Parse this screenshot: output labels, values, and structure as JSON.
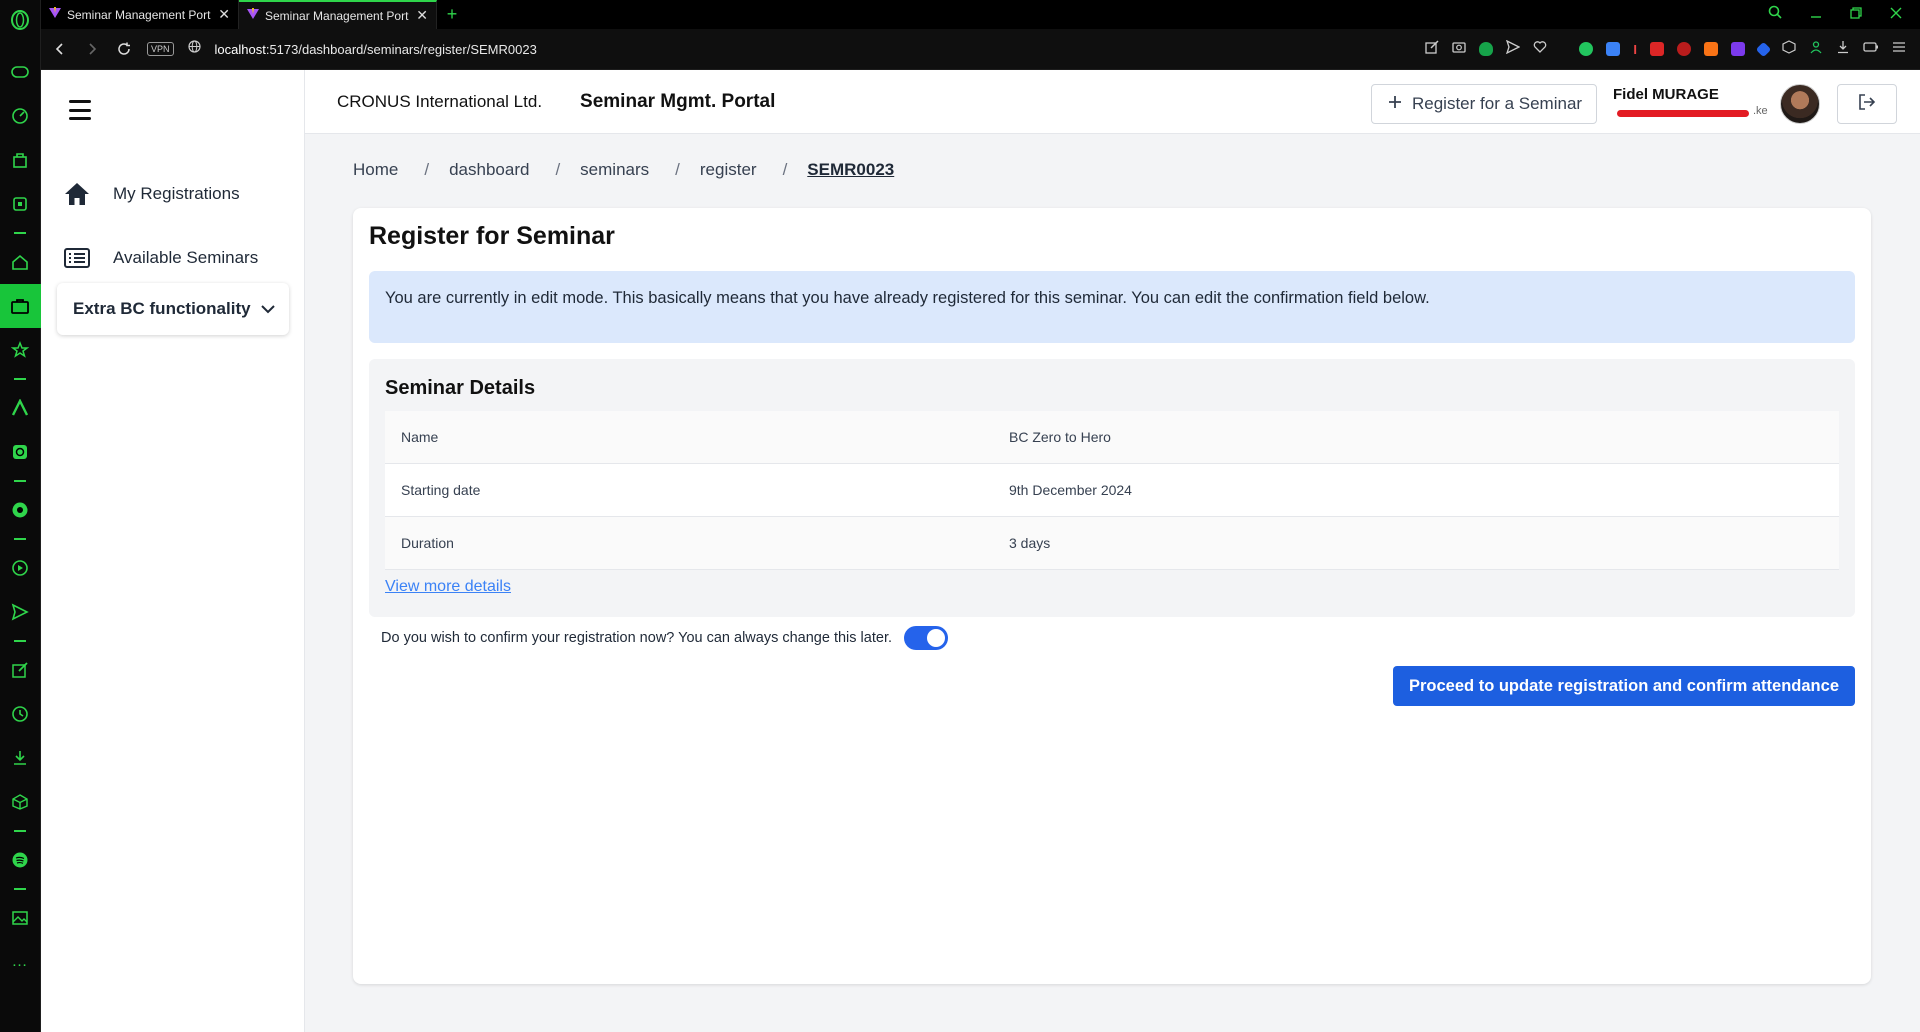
{
  "browser": {
    "tabs": [
      {
        "title": "Seminar Management Port"
      },
      {
        "title": "Seminar Management Port"
      }
    ],
    "vpn_label": "VPN",
    "url_host": "localhost",
    "url_path": ":5173/dashboard/seminars/register/SEMR0023"
  },
  "header": {
    "company": "CRONUS International Ltd.",
    "portal_title": "Seminar Mgmt. Portal",
    "register_button": "Register for a Seminar",
    "user_name": "Fidel MURAGE",
    "user_email_suffix": ".ke"
  },
  "sidebar": {
    "items": [
      {
        "label": "My Registrations",
        "icon": "home-icon"
      },
      {
        "label": "Available Seminars",
        "icon": "list-icon"
      }
    ],
    "extra_section": "Extra BC functionality"
  },
  "breadcrumb": [
    "Home",
    "dashboard",
    "seminars",
    "register",
    "SEMR0023"
  ],
  "page": {
    "title": "Register for Seminar",
    "alert": "You are currently in edit mode. This basically means that you have already registered for this seminar. You can edit the confirmation field below.",
    "details_title": "Seminar Details",
    "details": [
      {
        "key": "Name",
        "value": "BC Zero to Hero"
      },
      {
        "key": "Starting date",
        "value": "9th December 2024"
      },
      {
        "key": "Duration",
        "value": "3 days"
      }
    ],
    "view_more": "View more details",
    "confirm_question": "Do you wish to confirm your registration now? You can always change this later.",
    "confirm_toggle_on": true,
    "proceed_button": "Proceed to update registration and confirm attendance"
  },
  "colors": {
    "accent_green": "#2fd54b",
    "primary_blue": "#1d5fe0",
    "alert_bg": "#dbe8fc"
  }
}
